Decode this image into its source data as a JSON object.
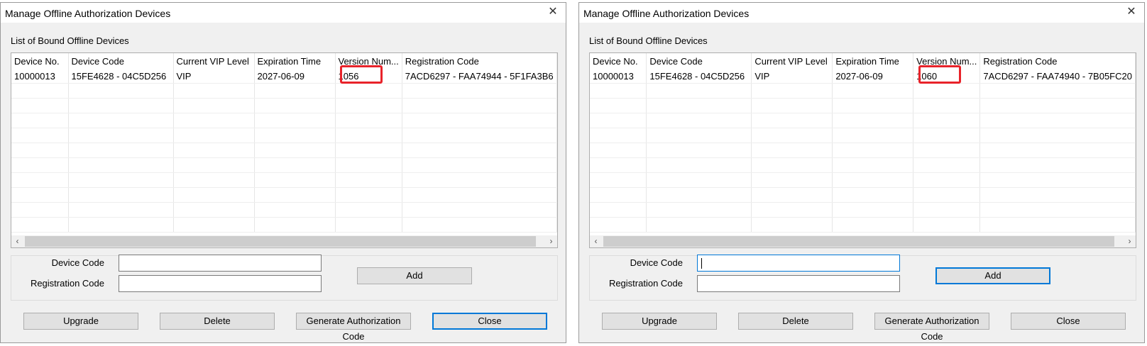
{
  "dialogs": [
    {
      "title": "Manage Offline Authorization Devices",
      "close_glyph": "✕",
      "list_label": "List of Bound Offline Devices",
      "columns": [
        "Device No.",
        "Device Code",
        "Current VIP Level",
        "Expiration Time",
        "Version Num...",
        "Registration Code"
      ],
      "rows": [
        [
          "10000013",
          "15FE4628 - 04C5D256",
          "VIP",
          "2027-06-09",
          "1056",
          "7ACD6297 - FAA74944 - 5F1FA3B6"
        ]
      ],
      "highlighted_value": "1056",
      "scroll_left": "‹",
      "scroll_right": "›",
      "form": {
        "device_code_label": "Device Code",
        "registration_code_label": "Registration Code",
        "device_code_value": "",
        "registration_code_value": "",
        "add_label": "Add"
      },
      "buttons": {
        "upgrade": "Upgrade",
        "delete": "Delete",
        "generate": "Generate Authorization Code",
        "close": "Close"
      },
      "default_button": "close"
    },
    {
      "title": "Manage Offline Authorization Devices",
      "close_glyph": "✕",
      "list_label": "List of Bound Offline Devices",
      "columns": [
        "Device No.",
        "Device Code",
        "Current VIP Level",
        "Expiration Time",
        "Version Num...",
        "Registration Code"
      ],
      "rows": [
        [
          "10000013",
          "15FE4628 - 04C5D256",
          "VIP",
          "2027-06-09",
          "1060",
          "7ACD6297 - FAA74940 - 7B05FC20"
        ]
      ],
      "highlighted_value": "1060",
      "scroll_left": "‹",
      "scroll_right": "›",
      "form": {
        "device_code_label": "Device Code",
        "registration_code_label": "Registration Code",
        "device_code_value": "",
        "registration_code_value": "",
        "add_label": "Add"
      },
      "buttons": {
        "upgrade": "Upgrade",
        "delete": "Delete",
        "generate": "Generate Authorization Code",
        "close": "Close"
      },
      "default_button": "add"
    }
  ],
  "colors": {
    "dialog_bg": "#f0f0f0",
    "focus_border": "#0078d7",
    "highlight_box": "#e8232a",
    "button_bg": "#e1e1e1"
  },
  "icons": {
    "close": "close-icon",
    "scroll_left": "chevron-left-icon",
    "scroll_right": "chevron-right-icon"
  }
}
